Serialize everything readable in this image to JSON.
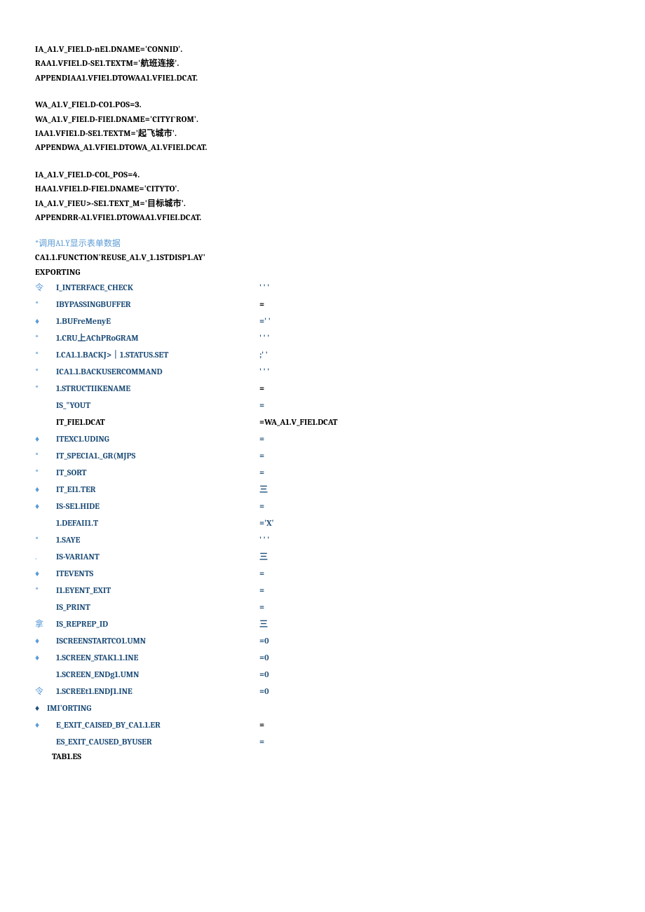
{
  "block1": {
    "l1": "IA_A1.V_FIE1.D-nE1.DNAME='CONNID'.",
    "l2": "RAA1.VFIE1.D-SE1.TEXTM='航班连接'.",
    "l3": "APPENDIAA1.VFIE1.DTOWAA1.VFIE1.DCAT."
  },
  "block2": {
    "l1": "WA_A1.V_FIE1.D-CO1.POS=3.",
    "l2": "WA_A1.V_FIEI.D-FIEI.DNAME='CITYΓROM'.",
    "l3": "IAA1.VFIE1.D-SE1.TEXTM='起飞城市'.",
    "l4": "APPENDWA_A1.VFIE1.DTOWA_A1.VFIEI.DCAT."
  },
  "block3": {
    "l1": "IA_A1.V_FIE1.D-COL_POS=4.",
    "l2": "HAA1.VFIE1.D-FIE1.DNAME='CITYTO'.",
    "l3": "IA_A1.V_FIEU>-SE1.TEXT_M='目标城市'.",
    "l4": "APPENDRR-A1.VFIE1.DTOWAA1.VFIEI.DCAT."
  },
  "comment": "*调用A1.Y显示表单数据",
  "call": {
    "l1": "CA1.1.FUNCTION'REUSE_A1.V_1.1STDISP1.AY'",
    "l2": "EXPORTING"
  },
  "params": [
    {
      "marker": "令",
      "mc": "blue",
      "name": "I_INTERFACE_CHECK",
      "nc": "blue",
      "value": "' ' '",
      "vc": "blue"
    },
    {
      "marker": "*",
      "mc": "blue",
      "name": "IBYPASSINGBUFFER",
      "nc": "blue",
      "value": "=",
      "vc": "black"
    },
    {
      "marker": "♦",
      "mc": "blue",
      "name": "1.BUFreMenyE",
      "nc": "blue",
      "value": "=' '",
      "vc": "blue"
    },
    {
      "marker": "*",
      "mc": "blue",
      "name": "1.CRU上AChPRoGRAM",
      "nc": "blue",
      "value": "' ' '",
      "vc": "blue"
    },
    {
      "marker": "*",
      "mc": "blue",
      "name": "I.CA1.1.BACKJ>｜1.STATUS.SET",
      "nc": "blue",
      "value": ";' '",
      "vc": "blue"
    },
    {
      "marker": "*",
      "mc": "blue",
      "name": "ICA1.1.BACKUSERCOMMAND",
      "nc": "blue",
      "value": "' ' '",
      "vc": "blue"
    },
    {
      "marker": "*",
      "mc": "blue",
      "name": "1.STRUCTIIKENAME",
      "nc": "blue",
      "value": "=",
      "vc": "black"
    },
    {
      "marker": "",
      "mc": "blue",
      "name": "IS_\"YOUT",
      "nc": "blue",
      "value": "=",
      "vc": "blue"
    },
    {
      "marker": "",
      "mc": "blue",
      "name": "IT_FIE1.DCAT",
      "nc": "black",
      "value": "=WA_A1.V_FIE1.DCAT",
      "vc": "black"
    },
    {
      "marker": "♦",
      "mc": "blue",
      "name": "ITEXC1.UDING",
      "nc": "blue",
      "value": "=",
      "vc": "blue"
    },
    {
      "marker": "*",
      "mc": "blue",
      "name": "IT_SPECIA1._GR(MJPS",
      "nc": "blue",
      "value": "=",
      "vc": "blue"
    },
    {
      "marker": "*",
      "mc": "blue",
      "name": "IT_SORT",
      "nc": "blue",
      "value": "=",
      "vc": "blue"
    },
    {
      "marker": "♦",
      "mc": "blue",
      "name": "IT_EI1.TER",
      "nc": "blue",
      "value": "三",
      "vc": "blue"
    },
    {
      "marker": "♦",
      "mc": "blue",
      "name": "IS-SE1.HIDE",
      "nc": "blue",
      "value": "=",
      "vc": "blue"
    },
    {
      "marker": "",
      "mc": "blue",
      "name": "1.DEFAII1.T",
      "nc": "blue",
      "value": "='X'",
      "vc": "blue"
    },
    {
      "marker": "*",
      "mc": "blue",
      "name": "1.SAYE",
      "nc": "blue",
      "value": "' ' '",
      "vc": "blue"
    },
    {
      "marker": ".",
      "mc": "blue",
      "name": "IS-VARIANT",
      "nc": "blue",
      "value": "三",
      "vc": "blue"
    },
    {
      "marker": "♦",
      "mc": "blue",
      "name": "ITEVENTS",
      "nc": "blue",
      "value": "=",
      "vc": "blue"
    },
    {
      "marker": "*",
      "mc": "blue",
      "name": "I1.EYENT_EXIT",
      "nc": "blue",
      "value": "=",
      "vc": "blue"
    },
    {
      "marker": "",
      "mc": "blue",
      "name": "IS_PRINT",
      "nc": "blue",
      "value": "=",
      "vc": "blue"
    },
    {
      "marker": "拿",
      "mc": "blue",
      "name": "IS_REPREP_ID",
      "nc": "blue",
      "value": "三",
      "vc": "blue"
    },
    {
      "marker": "♦",
      "mc": "blue",
      "name": "ISCREENSTARTCO1.UMN",
      "nc": "blue",
      "value": "=0",
      "vc": "blue"
    },
    {
      "marker": "♦",
      "mc": "blue",
      "name": "1.SCREEN_STAK1.1.INE",
      "nc": "blue",
      "value": "=0",
      "vc": "blue"
    },
    {
      "marker": "",
      "mc": "blue",
      "name": "1.SCREEN_ENDg1.UMN",
      "nc": "blue",
      "value": "=0",
      "vc": "blue"
    },
    {
      "marker": "令",
      "mc": "blue",
      "name": "1.SCREEt1.ENDJ1.INE",
      "nc": "blue",
      "value": "=0",
      "vc": "blue"
    }
  ],
  "importing": "IMI'ORTING",
  "importing_params": [
    {
      "marker": "♦",
      "mc": "blue",
      "name": "E_EXIT_CAISED_BY_CA1.1.ER",
      "nc": "blue",
      "value": "=",
      "vc": "black"
    },
    {
      "marker": "",
      "mc": "blue",
      "name": "ES_EXIT_CAUSED_BYUSER",
      "nc": "blue",
      "value": "=",
      "vc": "blue"
    }
  ],
  "tables": "TAB1.ES"
}
